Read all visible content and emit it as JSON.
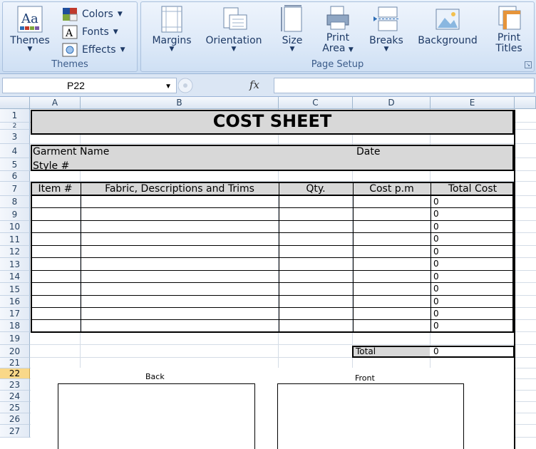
{
  "ribbon": {
    "themes_group": {
      "themes_label": "Themes",
      "colors_label": "Colors",
      "fonts_label": "Fonts",
      "effects_label": "Effects",
      "group_title": "Themes"
    },
    "page_setup_group": {
      "margins_label": "Margins",
      "orientation_label": "Orientation",
      "size_label": "Size",
      "print_area_label_1": "Print",
      "print_area_label_2": "Area",
      "breaks_label": "Breaks",
      "background_label": "Background",
      "print_titles_label_1": "Print",
      "print_titles_label_2": "Titles",
      "group_title": "Page Setup"
    }
  },
  "formula_bar": {
    "name_box": "P22",
    "fx_symbol": "fx",
    "formula": ""
  },
  "columns": [
    "A",
    "B",
    "C",
    "D",
    "E"
  ],
  "rows": [
    "1",
    "2",
    "3",
    "4",
    "5",
    "6",
    "7",
    "8",
    "9",
    "10",
    "11",
    "12",
    "13",
    "14",
    "15",
    "16",
    "17",
    "18",
    "19",
    "20",
    "21",
    "22",
    "23",
    "24",
    "25",
    "26",
    "27"
  ],
  "selected_row": "22",
  "sheet": {
    "title": "COST SHEET",
    "garment_name_label": "Garment Name",
    "date_label": "Date",
    "style_label": "Style #",
    "table_headers": [
      "Item #",
      "Fabric, Descriptions and Trims",
      "Qty.",
      "Cost p.m",
      "Total Cost"
    ],
    "total_cost_values": [
      "0",
      "0",
      "0",
      "0",
      "0",
      "0",
      "0",
      "0",
      "0",
      "0",
      "0"
    ],
    "total_label": "Total",
    "total_value": "0",
    "back_label": "Back",
    "front_label": "Front"
  },
  "colors": {
    "ribbon_text": "#1e3a66",
    "header_fill": "#d8d8d8",
    "selected_row_header": "#f9d889"
  }
}
